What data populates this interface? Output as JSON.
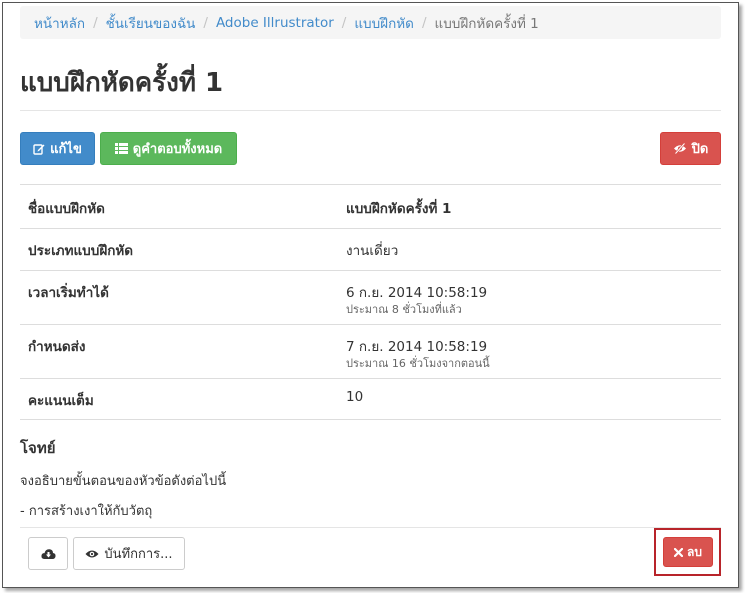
{
  "breadcrumb": {
    "items": [
      "หน้าหลัก",
      "ชั้นเรียนของฉัน",
      "Adobe Illrustrator",
      "แบบฝึกหัด"
    ],
    "current": "แบบฝึกหัดครั้งที่ 1"
  },
  "page_title": "แบบฝึกหัดครั้งที่ 1",
  "toolbar": {
    "edit_label": "แก้ไข",
    "edit_icon": "pencil-square-icon",
    "view_answers_label": "ดูคำตอบทั้งหมด",
    "view_answers_icon": "list-icon",
    "close_label": "ปิด",
    "close_icon": "eye-slash-icon"
  },
  "details": [
    {
      "label": "ชื่อแบบฝึกหัด",
      "value": "แบบฝึกหัดครั้งที่ 1",
      "value_bold": true
    },
    {
      "label": "ประเภทแบบฝึกหัด",
      "value": "งานเดี่ยว"
    },
    {
      "label": "เวลาเริ่มทำได้",
      "value": "6 ก.ย. 2014 10:58:19",
      "sub": "ประมาณ 8 ชั่วโมงที่แล้ว"
    },
    {
      "label": "กำหนดส่ง",
      "value": "7 ก.ย. 2014 10:58:19",
      "sub": "ประมาณ 16 ชั่วโมงจากตอนนี้"
    },
    {
      "label": "คะแนนเต็ม",
      "value": "10"
    }
  ],
  "problem": {
    "heading": "โจทย์",
    "lines": [
      "จงอธิบายขั้นตอนของหัวข้อดังต่อไปนี้",
      "- การสร้างเงาให้กับวัตถุ"
    ]
  },
  "footer": {
    "download_icon": "cloud-download-icon",
    "record_label": "บันทึกการ...",
    "record_icon": "eye-icon",
    "delete_label": "ลบ",
    "delete_icon": "times-icon"
  },
  "colors": {
    "primary": "#428bca",
    "success": "#5cb85c",
    "danger": "#d9534f",
    "highlight_border": "#b8242a"
  }
}
